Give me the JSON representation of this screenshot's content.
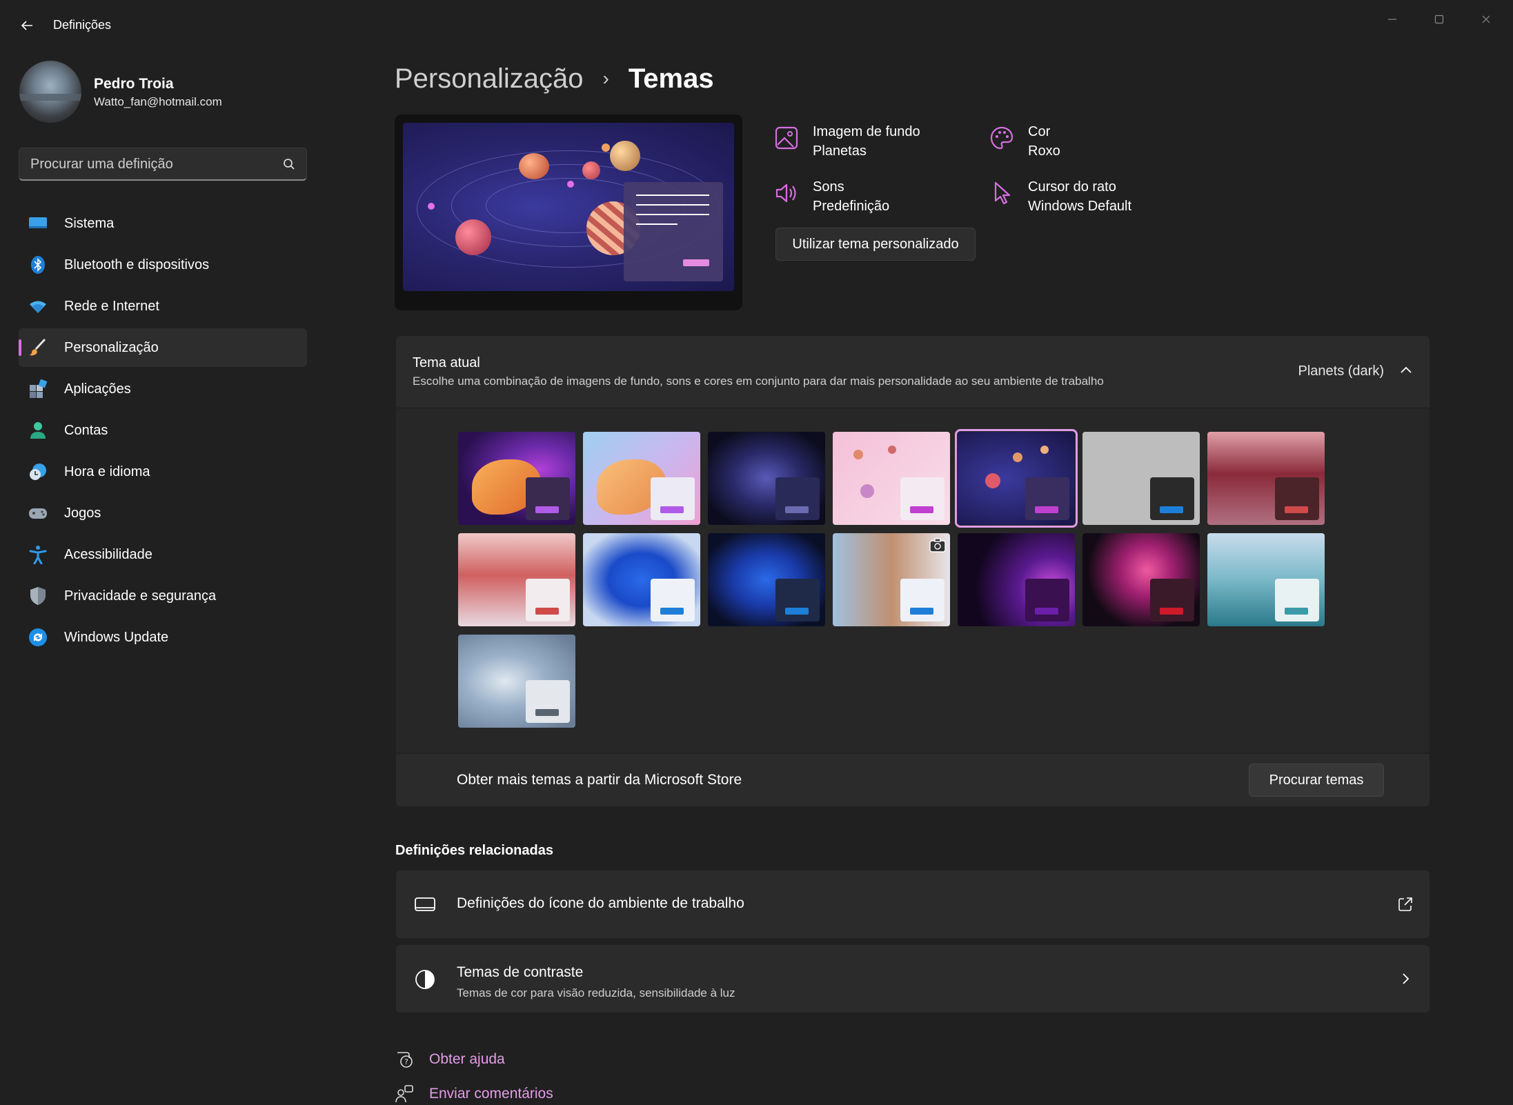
{
  "app": {
    "title": "Definições"
  },
  "profile": {
    "name": "Pedro Troia",
    "email": "Watto_fan@hotmail.com"
  },
  "search": {
    "placeholder": "Procurar uma definição"
  },
  "sidebar": {
    "items": [
      {
        "label": "Sistema",
        "icon": "monitor-icon",
        "active": false
      },
      {
        "label": "Bluetooth e dispositivos",
        "icon": "bluetooth-icon",
        "active": false
      },
      {
        "label": "Rede e Internet",
        "icon": "wifi-icon",
        "active": false
      },
      {
        "label": "Personalização",
        "icon": "paintbrush-icon",
        "active": true
      },
      {
        "label": "Aplicações",
        "icon": "apps-icon",
        "active": false
      },
      {
        "label": "Contas",
        "icon": "person-icon",
        "active": false
      },
      {
        "label": "Hora e idioma",
        "icon": "clock-globe-icon",
        "active": false
      },
      {
        "label": "Jogos",
        "icon": "gamepad-icon",
        "active": false
      },
      {
        "label": "Acessibilidade",
        "icon": "accessibility-icon",
        "active": false
      },
      {
        "label": "Privacidade e segurança",
        "icon": "shield-icon",
        "active": false
      },
      {
        "label": "Windows Update",
        "icon": "refresh-icon",
        "active": false
      }
    ]
  },
  "breadcrumb": {
    "parent": "Personalização",
    "separator": "›",
    "current": "Temas"
  },
  "theme_props": {
    "background": {
      "title": "Imagem de fundo",
      "value": "Planetas"
    },
    "color": {
      "title": "Cor",
      "value": "Roxo"
    },
    "sounds": {
      "title": "Sons",
      "value": "Predefinição"
    },
    "cursor": {
      "title": "Cursor do rato",
      "value": "Windows Default"
    },
    "custom_button": "Utilizar tema personalizado"
  },
  "current_theme": {
    "title": "Tema atual",
    "description": "Escolhe uma combinação de imagens de fundo, sons e cores em conjunto para dar mais personalidade ao seu ambiente de trabalho",
    "value": "Planets (dark)"
  },
  "themes": [
    {
      "name": "bloom-purple-dark",
      "selected": false
    },
    {
      "name": "bloom-light",
      "selected": false
    },
    {
      "name": "bloom-dark-blue",
      "selected": false
    },
    {
      "name": "planets-light",
      "selected": false
    },
    {
      "name": "planets-dark",
      "selected": true
    },
    {
      "name": "gray-blank",
      "selected": false
    },
    {
      "name": "desert-dark",
      "selected": false
    },
    {
      "name": "desert-light",
      "selected": false
    },
    {
      "name": "windows-light",
      "selected": false
    },
    {
      "name": "windows-dark",
      "selected": false
    },
    {
      "name": "spotlight",
      "selected": false
    },
    {
      "name": "glow",
      "selected": false
    },
    {
      "name": "flower",
      "selected": false
    },
    {
      "name": "lake",
      "selected": false
    },
    {
      "name": "captured-motion",
      "selected": false
    }
  ],
  "store": {
    "text": "Obter mais temas a partir da Microsoft Store",
    "button": "Procurar temas"
  },
  "related": {
    "title": "Definições relacionadas",
    "desktop_icons": {
      "title": "Definições do ícone do ambiente de trabalho"
    },
    "contrast": {
      "title": "Temas de contraste",
      "subtitle": "Temas de cor para visão reduzida, sensibilidade à luz"
    }
  },
  "links": {
    "help": "Obter ajuda",
    "feedback": "Enviar comentários"
  },
  "colors": {
    "accent": "#e59be8",
    "background": "#202020",
    "card": "#2b2b2b"
  }
}
